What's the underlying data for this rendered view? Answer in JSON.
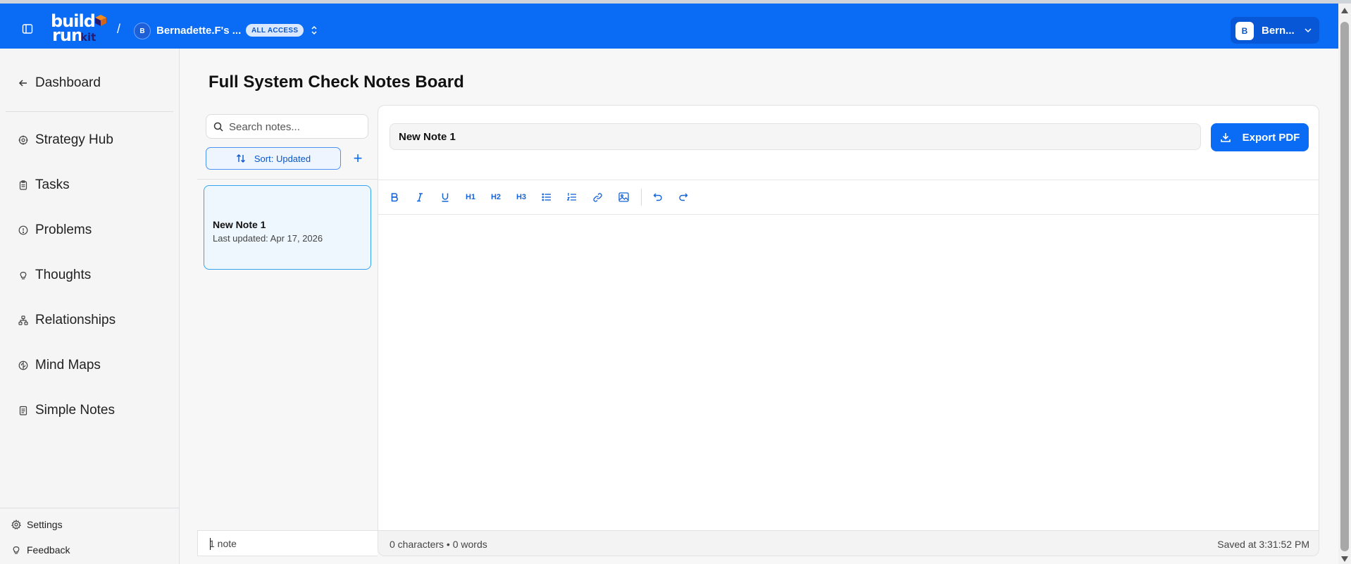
{
  "header": {
    "logo_line1": "build",
    "logo_line2": "run",
    "logo_line3": "kit",
    "separator": "/",
    "workspace_initial": "B",
    "workspace_name": "Bernadette.F's ...",
    "access_badge": "ALL ACCESS",
    "user_initial": "B",
    "user_name": "Bern...",
    "icons": {
      "sidebar_toggle": "sidebar-toggle-icon",
      "workspace_switch": "chevrons-up-down-icon",
      "user_menu": "chevron-down-icon"
    },
    "background_color": "#0a6cf5"
  },
  "sidebar": {
    "back_label": "Dashboard",
    "items": [
      {
        "label": "Strategy Hub",
        "icon": "strategy-icon"
      },
      {
        "label": "Tasks",
        "icon": "clipboard-icon"
      },
      {
        "label": "Problems",
        "icon": "alert-circle-icon"
      },
      {
        "label": "Thoughts",
        "icon": "lightbulb-icon"
      },
      {
        "label": "Relationships",
        "icon": "network-icon"
      },
      {
        "label": "Mind Maps",
        "icon": "brain-icon"
      },
      {
        "label": "Simple Notes",
        "icon": "notepad-icon"
      }
    ],
    "settings_label": "Settings",
    "feedback_label": "Feedback"
  },
  "main": {
    "page_title": "Full System Check Notes Board",
    "search_placeholder": "Search notes...",
    "sort_label": "Sort: Updated",
    "add_label": "+",
    "notes": [
      {
        "title": "New Note 1",
        "updated": "Last updated: Apr 17, 2026",
        "selected": true
      }
    ],
    "note_count": "1 note"
  },
  "editor": {
    "title_value": "New Note 1",
    "export_label": "Export PDF",
    "toolbar": [
      "bold",
      "italic",
      "underline",
      "heading-1",
      "heading-2",
      "heading-3",
      "bullet-list",
      "numbered-list",
      "link",
      "image",
      "undo",
      "redo"
    ],
    "toolbar_text": {
      "h1": "H1",
      "h2": "H2",
      "h3": "H3",
      "bold": "B"
    },
    "stats": "0 characters • 0 words",
    "saved": "Saved at 3:31:52 PM"
  },
  "colors": {
    "accent": "#0a6cf5",
    "selected_note_bg": "#eef7fe",
    "selected_note_border": "#36a3ee"
  }
}
